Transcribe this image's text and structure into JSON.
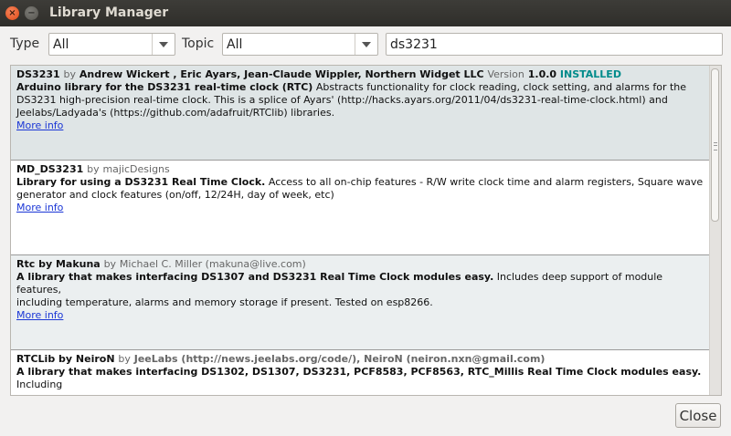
{
  "window": {
    "title": "Library Manager",
    "close_glyph": "×",
    "min_glyph": "−"
  },
  "filters": {
    "type_label": "Type",
    "type_value": "All",
    "topic_label": "Topic",
    "topic_value": "All",
    "search_value": "ds3231"
  },
  "libraries": [
    {
      "name": "DS3231",
      "by": "by",
      "authors": "Andrew Wickert , Eric Ayars, Jean-Claude Wippler, Northern Widget LLC",
      "version_label": "Version",
      "version": "1.0.0",
      "status": "INSTALLED",
      "summary": "Arduino library for the DS3231 real-time clock (RTC)",
      "desc_line1": " Abstracts functionality for clock reading, clock setting, and alarms for the",
      "desc_line2": "DS3231 high-precision real-time clock. This is a splice of Ayars' (http://hacks.ayars.org/2011/04/ds3231-real-time-clock.html) and",
      "desc_line3": "Jeelabs/Ladyada's (https://github.com/adafruit/RTClib) libraries.",
      "more_info": "More info"
    },
    {
      "name": "MD_DS3231",
      "by": "by",
      "authors": "majicDesigns",
      "summary": "Library for using a DS3231 Real Time Clock.",
      "desc_line1": " Access to all on-chip features - R/W write clock time and alarm registers, Square wave",
      "desc_line2": "generator and clock features (on/off, 12/24H, day of week, etc)",
      "more_info": "More info"
    },
    {
      "name": "Rtc by Makuna",
      "by": "by",
      "authors": "Michael C. Miller (makuna@live.com)",
      "summary": "A library that makes interfacing DS1307 and DS3231 Real Time Clock modules easy.",
      "desc_line1": " Includes deep support of module features,",
      "desc_line2": "including temperature, alarms and memory storage if present. Tested on esp8266.",
      "more_info": "More info"
    },
    {
      "name": "RTCLib by NeiroN",
      "by": "by",
      "authors_gray": "JeeLabs (http://news.jeelabs.org/code/), NeiroN (neiron.nxn@gmail.com)",
      "summary": "A library that makes interfacing DS1302, DS1307, DS3231, PCF8583, PCF8563, RTC_Millis Real Time Clock modules easy.",
      "desc_line1": " Including"
    }
  ],
  "footer": {
    "close_label": "Close"
  },
  "icons": {
    "dropdown": "chevron-down-icon",
    "scroll_grip": "grip-icon"
  }
}
